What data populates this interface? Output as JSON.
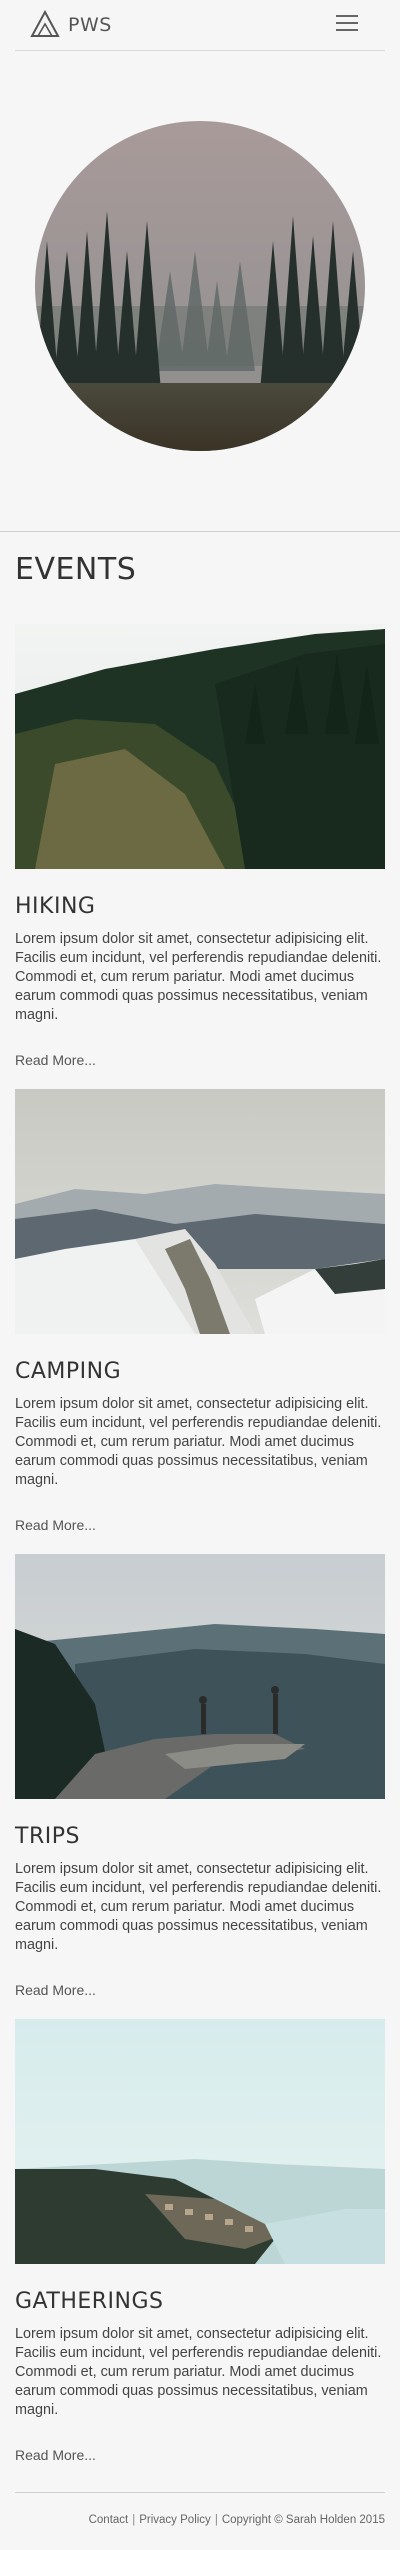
{
  "header": {
    "brand": "PWS"
  },
  "events_title": "EVENTS",
  "events": [
    {
      "title": "HIKING",
      "description": "Lorem ipsum dolor sit amet, consectetur adipisicing elit. Facilis eum incidunt, vel perferendis repudiandae deleniti. Commodi et, cum rerum pariatur. Modi amet ducimus earum commodi quas possimus necessitatibus, veniam magni.",
      "link": "Read More..."
    },
    {
      "title": "CAMPING",
      "description": "Lorem ipsum dolor sit amet, consectetur adipisicing elit. Facilis eum incidunt, vel perferendis repudiandae deleniti. Commodi et, cum rerum pariatur. Modi amet ducimus earum commodi quas possimus necessitatibus, veniam magni.",
      "link": "Read More..."
    },
    {
      "title": "TRIPS",
      "description": "Lorem ipsum dolor sit amet, consectetur adipisicing elit. Facilis eum incidunt, vel perferendis repudiandae deleniti. Commodi et, cum rerum pariatur. Modi amet ducimus earum commodi quas possimus necessitatibus, veniam magni.",
      "link": "Read More..."
    },
    {
      "title": "GATHERINGS",
      "description": "Lorem ipsum dolor sit amet, consectetur adipisicing elit. Facilis eum incidunt, vel perferendis repudiandae deleniti. Commodi et, cum rerum pariatur. Modi amet ducimus earum commodi quas possimus necessitatibus, veniam magni.",
      "link": "Read More..."
    }
  ],
  "footer": {
    "contact": "Contact",
    "privacy": "Privacy Policy",
    "copyright": "Copyright © Sarah Holden 2015"
  }
}
